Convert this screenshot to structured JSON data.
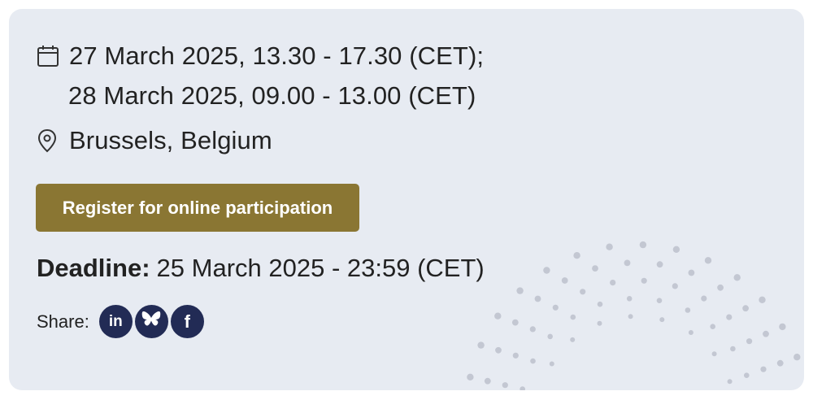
{
  "event": {
    "date_line_1": "27 March 2025, 13.30 - 17.30 (CET);",
    "date_line_2": "28 March 2025, 09.00 - 13.00 (CET)",
    "location": "Brussels, Belgium"
  },
  "register": {
    "label": "Register for online participation"
  },
  "deadline": {
    "label": "Deadline:",
    "value": "25 March 2025 - 23:59 (CET)"
  },
  "share": {
    "label": "Share:",
    "networks": [
      {
        "name": "linkedin",
        "glyph": "in"
      },
      {
        "name": "bluesky",
        "icon": "butterfly-icon"
      },
      {
        "name": "facebook",
        "glyph": "f"
      }
    ]
  },
  "colors": {
    "card_bg": "#e7ebf2",
    "button_bg": "#8a7633",
    "social_bg": "#222b55",
    "dots": "#c3c7d2"
  }
}
